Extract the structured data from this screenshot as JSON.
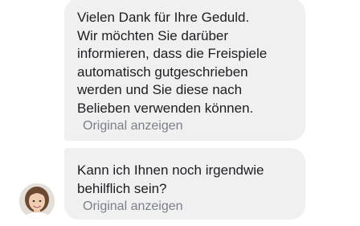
{
  "messages": [
    {
      "text": "Vielen Dank für Ihre Geduld.\nWir möchten Sie darüber\ninformieren, dass die Freispiele\nautomatisch gutgeschrieben\nwerden und Sie diese nach\nBelieben verwenden können.",
      "show_original": "Original anzeigen"
    },
    {
      "text": "Kann ich Ihnen noch irgendwie\nbehilflich sein?",
      "show_original": "Original anzeigen"
    }
  ],
  "agent": {
    "avatar_icon": "agent-avatar"
  },
  "colors": {
    "bubble_bg": "#f0f0f1",
    "text": "#1c1e21",
    "muted": "#7b8088"
  }
}
